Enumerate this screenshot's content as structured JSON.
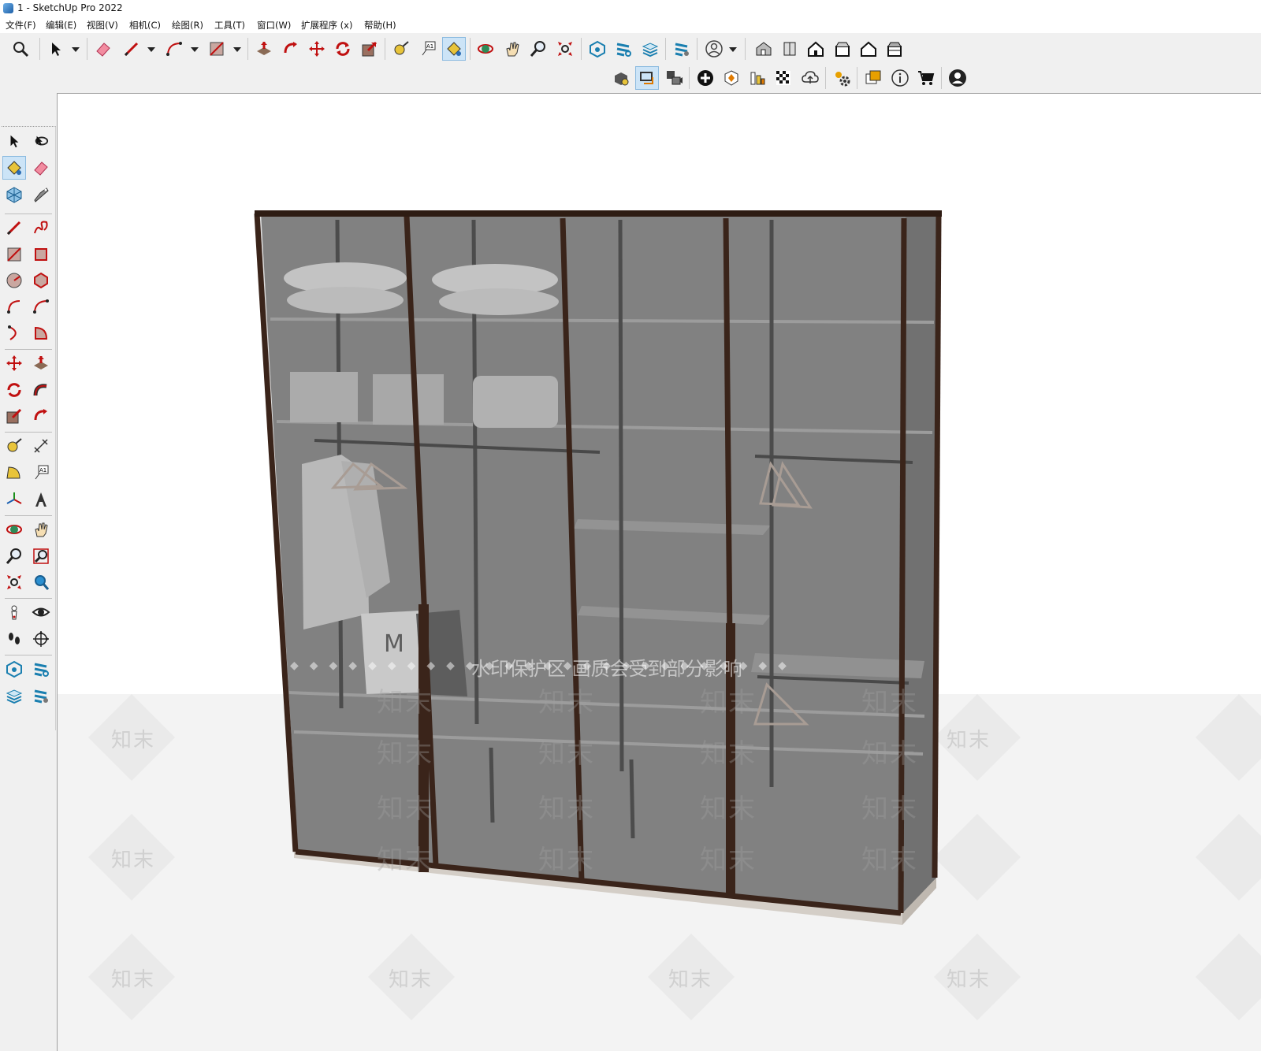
{
  "window": {
    "title": "1 - SketchUp Pro 2022"
  },
  "menu": [
    "文件(F)",
    "编辑(E)",
    "视图(V)",
    "相机(C)",
    "绘图(R)",
    "工具(T)",
    "窗口(W)",
    "扩展程序 (x)",
    "帮助(H)"
  ],
  "toolbar_top": [
    "zoom-window-icon",
    "select-icon",
    "eraser-icon",
    "pencil-icon",
    "arc-icon",
    "rectangle-icon",
    "push-pull-icon",
    "follow-me-icon",
    "move-icon",
    "rotate-icon",
    "scale-icon",
    "tape-measure-icon",
    "text-icon",
    "paint-bucket-icon",
    "orbit-icon",
    "pan-icon",
    "zoom-icon",
    "zoom-extents-icon",
    "warehouse-icon",
    "extension-warehouse-icon",
    "layout-icon",
    "extension-manager-icon",
    "account-icon",
    "iso-view-icon",
    "top-view-icon",
    "front-view-icon",
    "right-view-icon",
    "back-view-icon",
    "left-view-icon"
  ],
  "toolbar_second": [
    "sandbox-icon",
    "section-icon",
    "scenes-icon",
    "add-location-icon",
    "styles-icon",
    "shadows-icon",
    "fog-icon",
    "cloud-icon",
    "settings-icon",
    "components-icon",
    "info-icon",
    "cart-icon",
    "profile-icon"
  ],
  "watermark": {
    "band_text": "水印保护区  画质会受到部分影响",
    "logo_text": "知末"
  },
  "model_text": "M"
}
